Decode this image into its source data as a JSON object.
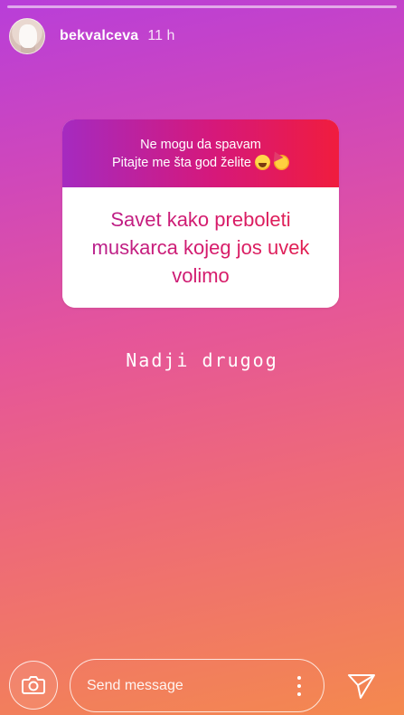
{
  "header": {
    "username": "bekvalceva",
    "time": "11 h"
  },
  "question_card": {
    "prompt_line1": "Ne mogu da spavam",
    "prompt_line2": "Pitajte me šta god želite",
    "prompt_emojis": [
      "laughing-emoji",
      "party-face-emoji"
    ],
    "question": "Savet kako preboleti muskarca kojeg jos uvek volimo"
  },
  "answer": {
    "text": "Nadji drugog"
  },
  "composer": {
    "placeholder": "Send message"
  },
  "icons": {
    "camera": "camera-icon",
    "more": "more-vertical-icon",
    "send": "send-icon"
  },
  "colors": {
    "background_top": "#b83ed9",
    "background_bottom": "#f4894e",
    "card_header_left": "#a52ac0",
    "card_header_right": "#f01c3e",
    "question_text": "#c2228f"
  }
}
